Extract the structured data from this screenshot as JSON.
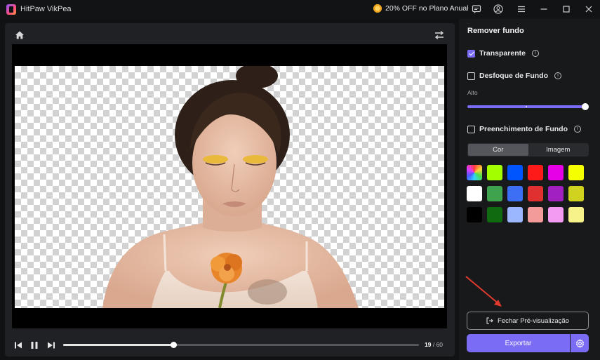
{
  "app": {
    "title": "HitPaw VikPea",
    "promo": "20% OFF no Plano Anual"
  },
  "titlebar_icons": [
    "chat-icon",
    "account-icon",
    "menu-icon",
    "minimize-icon",
    "maximize-icon",
    "close-icon"
  ],
  "player": {
    "current_frame": "19",
    "separator": " / ",
    "total_frames": "60",
    "progress_fraction": 0.31
  },
  "panel": {
    "title": "Remover fundo",
    "transparent": {
      "label": "Transparente",
      "checked": true
    },
    "blur": {
      "label": "Desfoque de Fundo",
      "checked": false,
      "level_label": "Alto",
      "level_fraction": 1.0
    },
    "fill": {
      "label": "Preenchimento de Fundo",
      "checked": false
    },
    "tabs": [
      {
        "label": "Cor",
        "active": true
      },
      {
        "label": "Imagem",
        "active": false
      }
    ],
    "swatches": [
      "rainbow",
      "#a3ff00",
      "#0055ff",
      "#ff1a1a",
      "#e600e6",
      "#f5ff00",
      "#ffffff",
      "#3fa34d",
      "#3d6ff5",
      "#e03030",
      "#a020c0",
      "#cfd21e",
      "#000000",
      "#0f6a10",
      "#9ab7ff",
      "#f39a9a",
      "#f39af3",
      "#f7f38a"
    ],
    "preview_button": "Fechar Pré-visualização",
    "export_button": "Exportar"
  },
  "colors": {
    "accent": "#7b6cf6",
    "annotation_arrow": "#e03a2e"
  }
}
